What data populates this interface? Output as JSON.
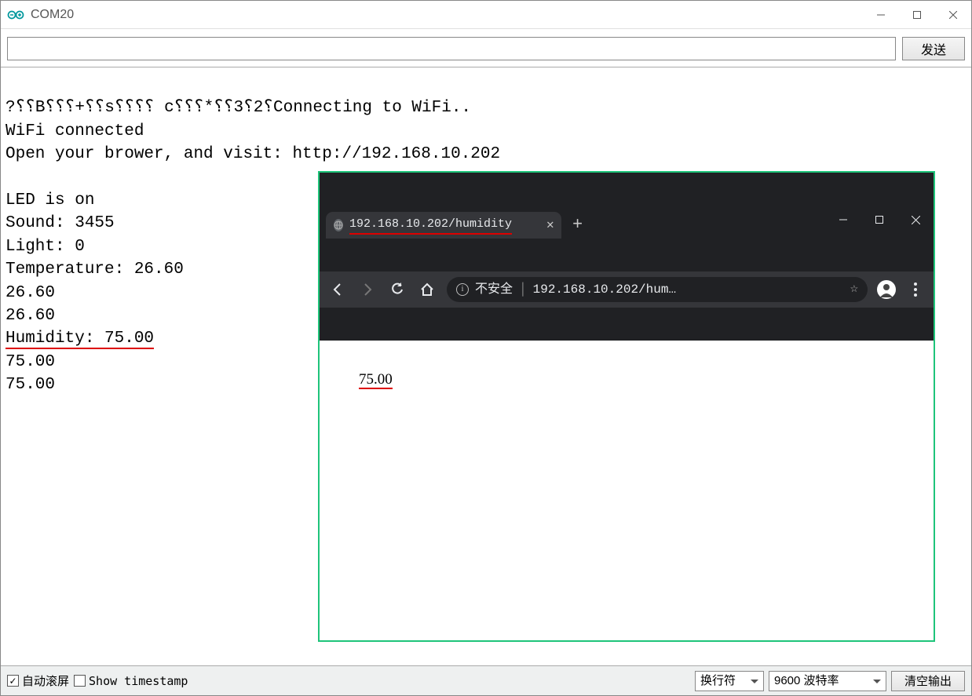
{
  "window": {
    "title": "COM20",
    "minimize": "min",
    "maximize": "max",
    "close": "close"
  },
  "topbar": {
    "input_value": "",
    "input_placeholder": "",
    "send_label": "发送"
  },
  "serial_output": {
    "line1": "?⸮⸮B⸮⸮⸮+⸮⸮s⸮⸮⸮⸮ c⸮⸮⸮*⸮⸮3⸮2⸮Connecting to WiFi..",
    "line2": "WiFi connected",
    "line3": "Open your brower, and visit: http://192.168.10.202",
    "line4": "",
    "line5": "LED is on",
    "line6": "Sound: 3455",
    "line7": "Light: 0",
    "line8": "Temperature: 26.60",
    "line9": "26.60",
    "line10": "26.60",
    "line11": "Humidity: 75.00",
    "line12": "75.00",
    "line13": "75.00"
  },
  "statusbar": {
    "autoscroll_label": "自动滚屏",
    "timestamp_label": "Show timestamp",
    "line_ending": "换行符",
    "baud": "9600 波特率",
    "clear_label": "清空输出"
  },
  "browser": {
    "tab_title": "192.168.10.202/humidity",
    "url_prefix": "不安全",
    "url_display": "192.168.10.202/hum…",
    "page_content": "75.00",
    "minimize": "min",
    "maximize": "max",
    "close": "close"
  }
}
